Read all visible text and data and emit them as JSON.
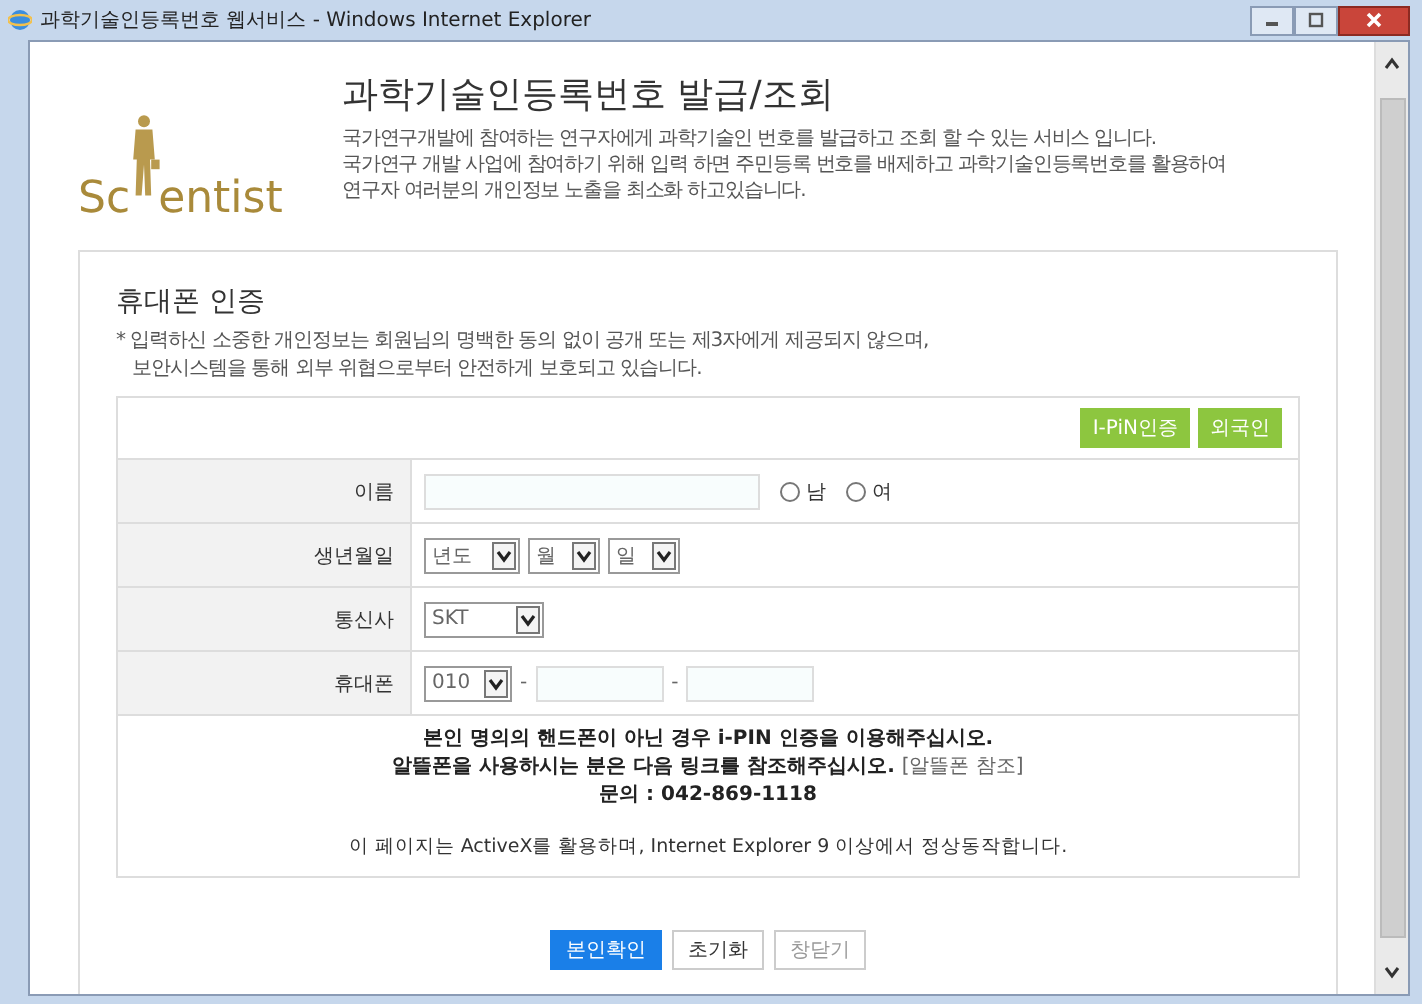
{
  "window": {
    "title": "과학기술인등록번호 웹서비스 - Windows Internet Explorer"
  },
  "header": {
    "logo_parts": [
      "Sc",
      "entist"
    ],
    "title": "과학기술인등록번호 발급/조회",
    "description": [
      "국가연구개발에 참여하는 연구자에게 과학기술인 번호를 발급하고 조회 할 수 있는 서비스 입니다.",
      "국가연구 개발 사업에 참여하기 위해 입력 하면 주민등록 번호를 배제하고 과학기술인등록번호를 활용하여",
      "연구자 여러분의 개인정보 노출을 최소화 하고있습니다."
    ]
  },
  "section": {
    "heading": "휴대폰 인증",
    "notes": [
      "* 입력하신 소중한 개인정보는 회원님의 명백한 동의 없이 공개 또는 제3자에게 제공되지 않으며,",
      "보안시스템을 통해 외부 위협으로부터 안전하게 보호되고 있습니다."
    ]
  },
  "auth_buttons": [
    "I-PiN인증",
    "외국인"
  ],
  "form_rows": [
    {
      "kind": "name",
      "label": "이름",
      "options": [
        {
          "label": "남",
          "selected": false
        },
        {
          "label": "여",
          "selected": false
        }
      ]
    },
    {
      "kind": "birthdate",
      "label": "생년월일",
      "selects": [
        "년도",
        "월",
        "일"
      ]
    },
    {
      "kind": "carrier",
      "label": "통신사",
      "selects": [
        "SKT"
      ]
    },
    {
      "kind": "phone",
      "label": "휴대폰",
      "selects": [
        "010"
      ],
      "separators": [
        "-",
        "-"
      ]
    }
  ],
  "notice": {
    "line_1": "본인 명의의 핸드폰이 아닌 경우 i-PIN 인증을 이용해주십시오.",
    "line_2": "알뜰폰을 사용하시는 분은 다음 링크를 참조해주십시오.",
    "link": "[알뜰폰 참조]",
    "contact": "문의 : 042-869-1118",
    "footer": "이 페이지는 ActiveX를 활용하며, Internet Explorer 9 이상에서 정상동작합니다."
  },
  "buttons": [
    {
      "label": "본인확인",
      "kind": "primary"
    },
    {
      "label": "초기화",
      "kind": "default"
    },
    {
      "label": "창닫기",
      "kind": "light"
    }
  ]
}
